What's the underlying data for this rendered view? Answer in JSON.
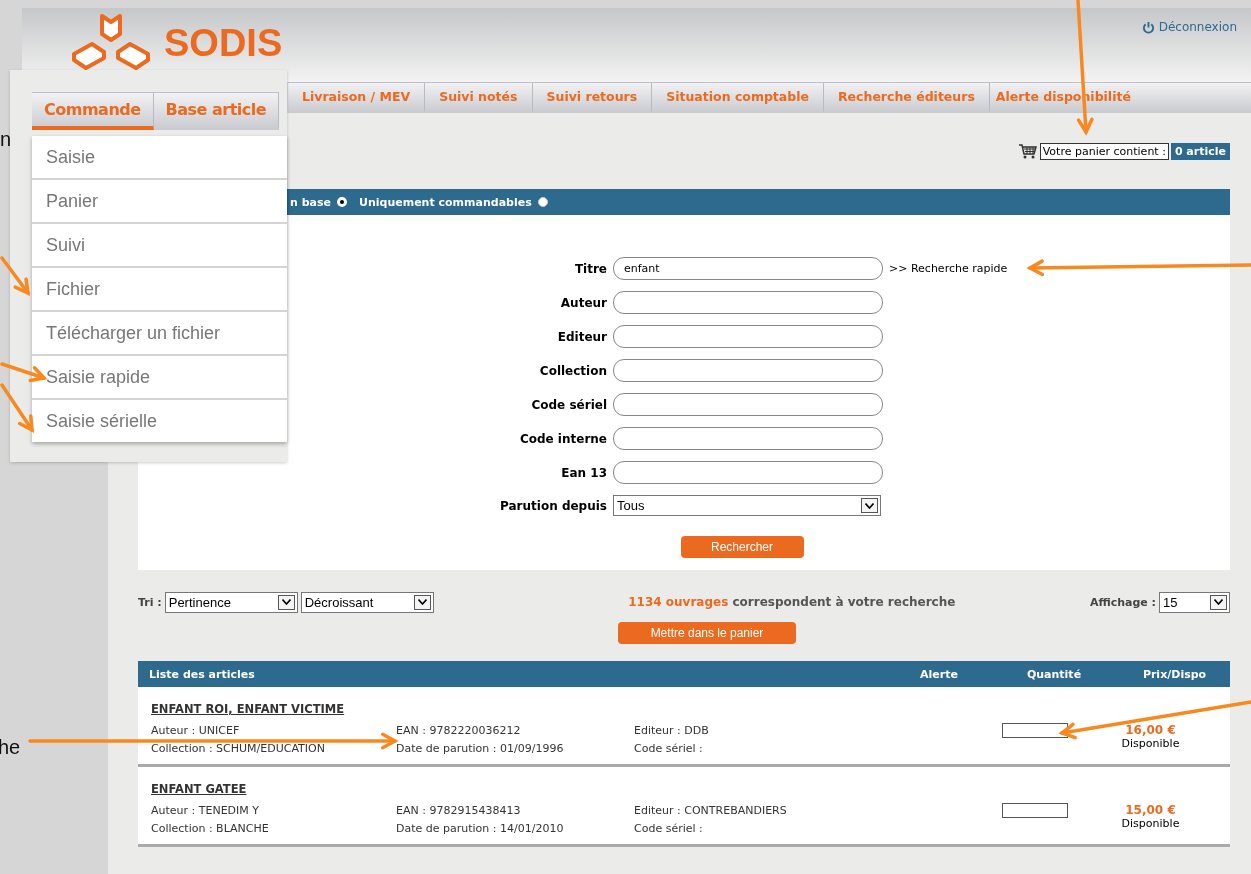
{
  "header": {
    "logo_text": "SODIS",
    "logout": "Déconnexion"
  },
  "menu_inset": {
    "tabs": [
      {
        "label": "Commande",
        "selected": true
      },
      {
        "label": "Base article",
        "selected": false
      }
    ],
    "items": [
      "Saisie",
      "Panier",
      "Suivi",
      "Fichier",
      "Télécharger un fichier",
      "Saisie rapide",
      "Saisie sérielle"
    ]
  },
  "nav_tabs": [
    {
      "label": "Livraison / MEV",
      "selected": false
    },
    {
      "label": "Suivi notés",
      "selected": false
    },
    {
      "label": "Suivi retours",
      "selected": false
    },
    {
      "label": "Situation comptable",
      "selected": false
    },
    {
      "label": "Recherche éditeurs",
      "selected": false
    },
    {
      "label": "Alerte disponibilité",
      "selected": false
    }
  ],
  "cart": {
    "label": "Votre panier contient :",
    "count": "0 article"
  },
  "scope_options": [
    {
      "label": "n base",
      "selected": true
    },
    {
      "label": "Uniquement commandables",
      "selected": false
    }
  ],
  "search_form": {
    "fields": [
      {
        "kind": "text",
        "label": "Titre",
        "value": "enfant",
        "link": ">> Recherche rapide"
      },
      {
        "kind": "text",
        "label": "Auteur"
      },
      {
        "kind": "text",
        "label": "Editeur"
      },
      {
        "kind": "text",
        "label": "Collection"
      },
      {
        "kind": "text",
        "label": "Code sériel"
      },
      {
        "kind": "text",
        "label": "Code interne"
      },
      {
        "kind": "text",
        "label": "Ean 13"
      },
      {
        "kind": "select",
        "label": "Parution depuis",
        "value": "Tous"
      }
    ],
    "submit": "Rechercher"
  },
  "results_bar": {
    "sort_label": "Tri :",
    "sort_by": "Pertinence",
    "order": "Décroissant",
    "count": "1134 ouvrages",
    "count_text": "correspondent à votre recherche",
    "display_label": "Affichage :",
    "display_value": "15"
  },
  "add_to_cart": "Mettre dans le panier",
  "table": {
    "columns": [
      "Liste des articles",
      "Alerte",
      "Quantité",
      "Prix/Dispo"
    ],
    "rows": [
      {
        "title": "ENFANT ROI, ENFANT VICTIME",
        "author": "Auteur : UNICEF",
        "collection": "Collection : SCHUM/EDUCATION",
        "ean": "EAN : 9782220036212",
        "date": "Date de parution : 01/09/1996",
        "publisher": "Editeur : DDB",
        "serial": "Code sériel :",
        "price": "16,00 €",
        "availability": "Disponible"
      },
      {
        "title": "ENFANT GATEE",
        "author": "Auteur : TENEDIM Y",
        "collection": "Collection : BLANCHE",
        "ean": "EAN : 9782915438413",
        "date": "Date de parution : 14/01/2010",
        "publisher": "Editeur : CONTREBANDIERS",
        "serial": "Code sériel :",
        "price": "15,00 €",
        "availability": "Disponible"
      }
    ]
  },
  "annotations": [
    {
      "text": "n"
    },
    {
      "text": "he"
    }
  ]
}
